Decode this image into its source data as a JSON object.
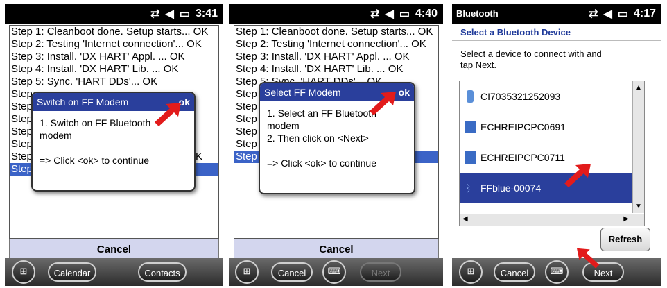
{
  "panel1": {
    "status": {
      "time": "3:41"
    },
    "log": [
      "Step 1: Cleanboot done. Setup starts... OK",
      "Step 2: Testing 'Internet connection'... OK",
      "Step 3: Install. 'DX HART' Appl. ... OK",
      "Step 4: Install. 'DX HART' Lib. ... OK",
      "Step 5: Sync. 'HART DDs'... OK",
      "Step",
      "Step",
      "Step",
      "Step",
      "Step",
      "Step",
      "Step"
    ],
    "log_tail_k": "K",
    "dialog": {
      "title": "Switch on FF Modem",
      "ok": "ok",
      "body": "1. Switch on FF Bluetooth\nmodem\n\n=> Click <ok> to continue"
    },
    "cancel": "Cancel",
    "taskbar": {
      "left": "Calendar",
      "right": "Contacts"
    }
  },
  "panel2": {
    "status": {
      "time": "4:40"
    },
    "log": [
      "Step 1: Cleanboot done. Setup starts... OK",
      "Step 2: Testing 'Internet connection'... OK",
      "Step 3: Install. 'DX HART' Appl. ... OK",
      "Step 4: Install. 'DX HART' Lib. ... OK",
      "Step 5: Sync. 'HART DDs'... OK",
      "Step 6",
      "Step 7",
      "Step 8",
      "Step 9",
      "Step 1",
      "Step 1"
    ],
    "dialog": {
      "title": "Select FF Modem",
      "ok": "ok",
      "body": "1. Select an FF Bluetooth\nmodem\n2. Then click on <Next>\n\n=> Click <ok> to continue"
    },
    "cancel": "Cancel",
    "taskbar": {
      "left": "Cancel",
      "right": "Next"
    }
  },
  "panel3": {
    "status": {
      "app": "Bluetooth",
      "time": "4:17"
    },
    "heading": "Select a Bluetooth Device",
    "instructions": "Select a device to connect with and tap Next.",
    "devices": [
      "CI7035321252093",
      "ECHREIPCPC0691",
      "ECHREIPCPC0711",
      "FFblue-00074"
    ],
    "refresh": "Refresh",
    "taskbar": {
      "left": "Cancel",
      "right": "Next"
    }
  },
  "colors": {
    "accent": "#2a3f9c",
    "selection": "#3b63c7",
    "arrow": "#e21b1b"
  }
}
